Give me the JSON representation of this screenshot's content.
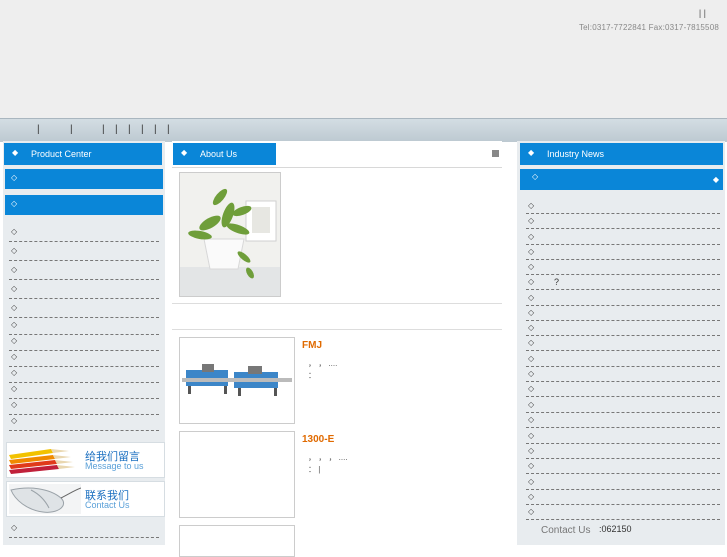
{
  "header": {
    "top_links": "|   |",
    "contact_line": "Tel:0317-7722841 Fax:0317-7815508"
  },
  "navbar": {
    "separators": [
      "|",
      "|",
      "|",
      "|",
      "|",
      "|",
      "|",
      "|"
    ]
  },
  "left": {
    "title": "Product Center",
    "bullet": "◇",
    "promos": [
      {
        "cn": "给我们留言",
        "en": "Message to us"
      },
      {
        "cn": "联系我们",
        "en": "Contact Us"
      }
    ]
  },
  "middle": {
    "title": "About Us",
    "products": [
      {
        "title": "FMJ",
        "desc": "，          ，  ....",
        "desc2": "："
      },
      {
        "title": "1300-E",
        "desc": "，    ，      ，  ....",
        "desc2": "：  |"
      }
    ]
  },
  "right": {
    "title": "Industry News",
    "bullet": "◇",
    "question": "?",
    "contact_label": "Contact Us",
    "zip": ":062150"
  },
  "colors": {
    "accent": "#0a86d8",
    "product_title": "#e06a00",
    "header_bg": "#eeeeee"
  },
  "icons": [
    "diamond-icon",
    "square-icon",
    "pencils-icon",
    "mouse-icon"
  ]
}
